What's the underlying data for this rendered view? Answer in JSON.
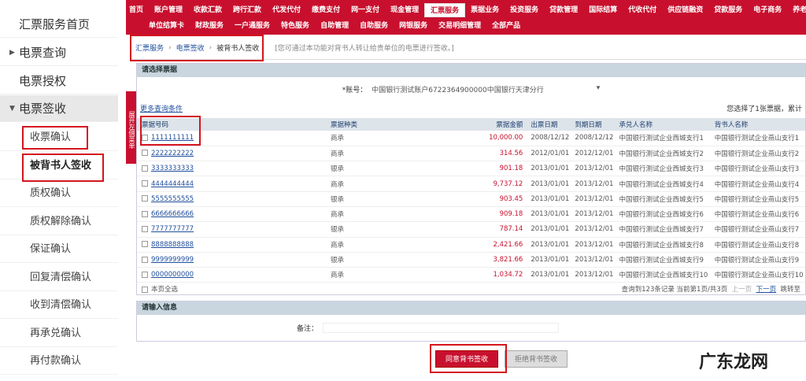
{
  "sidebar": {
    "items": [
      {
        "label": "汇票服务首页"
      },
      {
        "label": "电票查询"
      },
      {
        "label": "电票授权"
      },
      {
        "label": "电票签收"
      }
    ],
    "sub": [
      {
        "label": "收票确认"
      },
      {
        "label": "被背书人签收"
      },
      {
        "label": "质权确认"
      },
      {
        "label": "质权解除确认"
      },
      {
        "label": "保证确认"
      },
      {
        "label": "回复清偿确认"
      },
      {
        "label": "收到清偿确认"
      },
      {
        "label": "再承兑确认"
      },
      {
        "label": "再付款确认"
      }
    ]
  },
  "nav": {
    "row1": [
      "首页",
      "账户管理",
      "收款汇款",
      "跨行汇款",
      "代发代付",
      "缴费支付",
      "网一支付",
      "现金管理",
      "汇票服务",
      "票据业务",
      "投资服务",
      "贷款管理",
      "国际结算",
      "代收代付",
      "供应链融资",
      "贷款服务",
      "电子商务",
      "养老金"
    ],
    "row2": [
      "单位结算卡",
      "财政服务",
      "一户通服务",
      "特色服务",
      "自助管理",
      "自助服务",
      "网银服务",
      "交易明细管理",
      "全部产品"
    ],
    "active": "汇票服务"
  },
  "breadcrumb": {
    "items": [
      "汇票服务",
      "电票签收",
      "被背书人签收"
    ],
    "hint": "[您可通过本功能对背书人转让给贵单位的电票进行签收。]"
  },
  "sidetab": "展开左侧菜单",
  "select_section": "请选择票据",
  "account": {
    "label": "*账号：",
    "value": "中国银行测试账户6722364900000中国银行天津分行"
  },
  "more_link": "更多查询条件",
  "summary": "您选择了1张票据，累计",
  "table": {
    "headers": [
      "票据号码",
      "票据种类",
      "票据金额",
      "出票日期",
      "到期日期",
      "承兑人名称",
      "背书人名称"
    ],
    "rows": [
      [
        "1111111111",
        "商承",
        "10,000.00",
        "2008/12/12",
        "2008/12/12",
        "中国银行测试企业西城支行1",
        "中国银行测试企业燕山支行1"
      ],
      [
        "2222222222",
        "商承",
        "314.56",
        "2012/01/01",
        "2012/12/01",
        "中国银行测试企业西城支行2",
        "中国银行测试企业燕山支行2"
      ],
      [
        "3333333333",
        "银承",
        "901.18",
        "2013/01/01",
        "2013/12/01",
        "中国银行测试企业西城支行3",
        "中国银行测试企业燕山支行3"
      ],
      [
        "4444444444",
        "商承",
        "9,737.12",
        "2013/01/01",
        "2013/12/01",
        "中国银行测试企业西城支行4",
        "中国银行测试企业燕山支行4"
      ],
      [
        "5555555555",
        "银承",
        "903.45",
        "2013/01/01",
        "2013/12/01",
        "中国银行测试企业西城支行5",
        "中国银行测试企业燕山支行5"
      ],
      [
        "6666666666",
        "商承",
        "909.18",
        "2013/01/01",
        "2013/12/01",
        "中国银行测试企业西城支行6",
        "中国银行测试企业燕山支行6"
      ],
      [
        "7777777777",
        "银承",
        "787.14",
        "2013/01/01",
        "2013/12/01",
        "中国银行测试企业西城支行7",
        "中国银行测试企业燕山支行7"
      ],
      [
        "8888888888",
        "商承",
        "2,421.66",
        "2013/01/01",
        "2013/12/01",
        "中国银行测试企业西城支行8",
        "中国银行测试企业燕山支行8"
      ],
      [
        "9999999999",
        "银承",
        "3,821.66",
        "2013/01/01",
        "2013/12/01",
        "中国银行测试企业西城支行9",
        "中国银行测试企业燕山支行9"
      ],
      [
        "0000000000",
        "商承",
        "1,034.72",
        "2013/01/01",
        "2013/12/01",
        "中国银行测试企业西城支行10",
        "中国银行测试企业燕山支行10"
      ]
    ]
  },
  "footer": {
    "select_all": "本页全选",
    "pager_info": "查询到123条记录 当前第1页/共3页",
    "prev_first": "上一页",
    "next": "下一页",
    "last": "跳转至"
  },
  "input_section": "请输入信息",
  "remark_label": "备注：",
  "buttons": {
    "confirm": "同意背书签收",
    "reject": "拒绝背书签收"
  },
  "watermark": "广东龙网"
}
